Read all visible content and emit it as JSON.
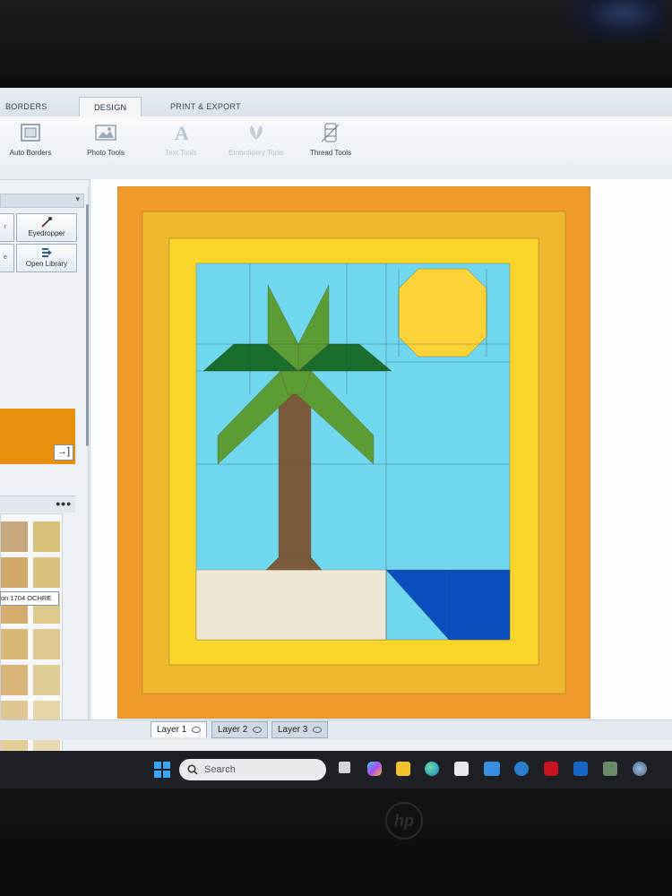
{
  "ribbon": {
    "tabs": [
      "BORDERS",
      "DESIGN",
      "PRINT & EXPORT"
    ],
    "active_tab": "DESIGN",
    "tools": [
      {
        "label": "Auto Borders",
        "icon": "auto-borders-icon",
        "enabled": true
      },
      {
        "label": "Photo Tools",
        "icon": "photo-tools-icon",
        "enabled": true
      },
      {
        "label": "Text Tools",
        "icon": "text-tools-icon",
        "enabled": false
      },
      {
        "label": "Embroidery Tools",
        "icon": "embroidery-tools-icon",
        "enabled": false
      },
      {
        "label": "Thread Tools",
        "icon": "thread-tools-icon",
        "enabled": true
      }
    ]
  },
  "left_panel": {
    "buttons": [
      {
        "label": "Eyedropper",
        "icon": "eyedropper-icon"
      },
      {
        "label": "Open Library",
        "icon": "open-library-icon"
      }
    ],
    "cut_left_labels": [
      "r",
      "e"
    ],
    "selected_color": "#e8900e",
    "tooltip": "on 1704 OCHRE",
    "palette_menu": "•••",
    "swatches": [
      "#c9a77d",
      "#d9c17a",
      "#d0a86a",
      "#dcc27c",
      "#d6ad6d",
      "#dec98c",
      "#d8b777",
      "#e0c891",
      "#d9b57a",
      "#e0cd96",
      "#dfc690",
      "#e6d6a6",
      "#e2cc98",
      "#e8dab0",
      "#e6d3a6",
      "#ece0bb"
    ]
  },
  "quilt": {
    "colors": {
      "outer_border": "#f09a2c",
      "mid_border": "#f0b82e",
      "inner_border": "#fad52a",
      "sky": "#6fd8ee",
      "sun": "#fbd337",
      "leaf_dark": "#1a6e2c",
      "leaf_light": "#5c9c34",
      "trunk": "#7c5a3c",
      "sand": "#efe7d3",
      "water": "#0a4ec0"
    }
  },
  "layers": [
    {
      "label": "Layer 1",
      "active": true
    },
    {
      "label": "Layer 2",
      "active": false
    },
    {
      "label": "Layer 3",
      "active": false
    }
  ],
  "taskbar": {
    "search_placeholder": "Search",
    "apps": [
      "windows-start-icon",
      "task-view-icon",
      "copilot-icon",
      "file-explorer-icon",
      "edge-icon",
      "store-icon",
      "mywp-icon",
      "help-icon",
      "mcafee-icon",
      "outlook-icon",
      "quilt-app-icon",
      "browser-icon"
    ]
  },
  "device": {
    "brand": "hp"
  }
}
